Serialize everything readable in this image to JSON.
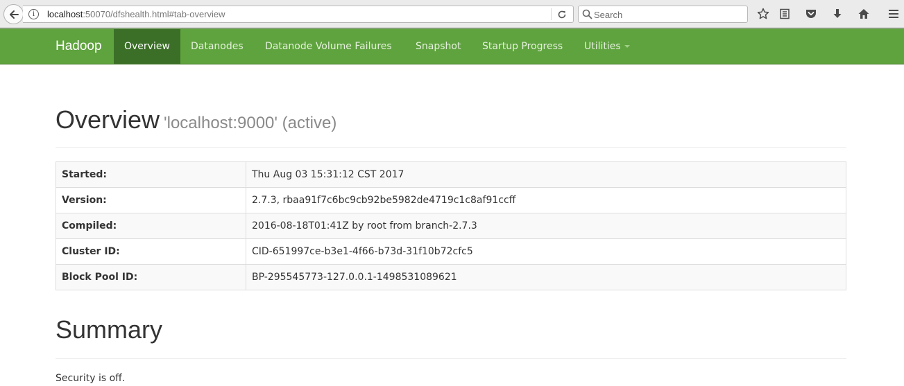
{
  "browser": {
    "url_host": "localhost",
    "url_rest": ":50070/dfshealth.html#tab-overview",
    "search_placeholder": "Search",
    "icons": [
      "back-icon",
      "info-icon",
      "reload-icon",
      "search-icon",
      "bookmark-star-icon",
      "reading-list-icon",
      "pocket-icon",
      "download-icon",
      "home-icon",
      "menu-icon"
    ]
  },
  "navbar": {
    "brand": "Hadoop",
    "items": [
      {
        "label": "Overview",
        "active": true
      },
      {
        "label": "Datanodes"
      },
      {
        "label": "Datanode Volume Failures"
      },
      {
        "label": "Snapshot"
      },
      {
        "label": "Startup Progress"
      },
      {
        "label": "Utilities"
      }
    ],
    "colors": {
      "background": "#5fa33e",
      "active": "#3b6f27"
    }
  },
  "overview": {
    "title": "Overview",
    "subtitle": "'localhost:9000' (active)",
    "rows": [
      {
        "label": "Started:",
        "value": "Thu Aug 03 15:31:12 CST 2017"
      },
      {
        "label": "Version:",
        "value": "2.7.3, rbaa91f7c6bc9cb92be5982de4719c1c8af91ccff"
      },
      {
        "label": "Compiled:",
        "value": "2016-08-18T01:41Z by root from branch-2.7.3"
      },
      {
        "label": "Cluster ID:",
        "value": "CID-651997ce-b3e1-4f66-b73d-31f10b72cfc5"
      },
      {
        "label": "Block Pool ID:",
        "value": "BP-295545773-127.0.0.1-1498531089621"
      }
    ]
  },
  "summary": {
    "title": "Summary",
    "security": "Security is off."
  }
}
